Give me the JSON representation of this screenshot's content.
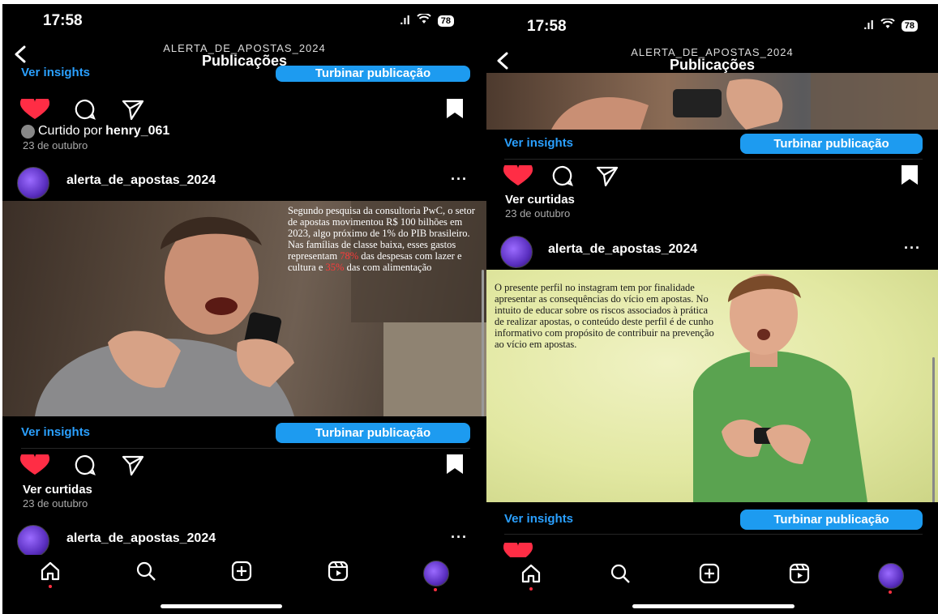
{
  "left": {
    "status": {
      "time": "17:58",
      "battery": "78"
    },
    "nav": {
      "username": "ALERTA_DE_APOSTAS_2024",
      "title": "Publicações"
    },
    "top": {
      "insights_label": "Ver insights",
      "boost_label": "Turbinar publicação",
      "liked_prefix": "Curtido por ",
      "liked_user": "henry_061",
      "date": "23 de outubro"
    },
    "post1": {
      "username": "alerta_de_apostas_2024",
      "caption_before_78": "Segundo pesquisa da consultoria PwC, o setor de apostas movimentou R$ 100 bilhões em 2023, algo próximo de 1% do PIB brasileiro. Nas famílias de classe baixa, esses gastos representam ",
      "pct_leisure": "78%",
      "caption_middle": " das despesas com lazer e cultura e ",
      "pct_food": "35%",
      "caption_after_35": " das com alimentação",
      "insights_label": "Ver insights",
      "boost_label": "Turbinar publicação",
      "likes_label": "Ver curtidas",
      "date": "23 de outubro"
    },
    "post2": {
      "username": "alerta_de_apostas_2024"
    }
  },
  "right": {
    "status": {
      "time": "17:58",
      "battery": "78"
    },
    "nav": {
      "username": "ALERTA_DE_APOSTAS_2024",
      "title": "Publicações"
    },
    "top": {
      "insights_label": "Ver insights",
      "boost_label": "Turbinar publicação",
      "likes_label": "Ver curtidas",
      "date": "23 de outubro"
    },
    "post1": {
      "username": "alerta_de_apostas_2024",
      "caption": "O presente perfil no instagram tem por finalidade apresentar as consequências do vício em apostas. No intuito de educar sobre os riscos associados à prática de realizar apostas, o conteúdo deste perfil é de cunho informativo com propósito de contribuir na prevenção ao vício em apostas.",
      "insights_label": "Ver insights",
      "boost_label": "Turbinar publicação"
    }
  },
  "icons": {
    "back": "back-chevron-icon",
    "heart": "heart-icon",
    "comment": "comment-icon",
    "share": "share-icon",
    "save": "bookmark-icon",
    "more": "more-icon",
    "home": "home-icon",
    "search": "search-icon",
    "create": "create-icon",
    "reels": "reels-icon",
    "profile": "profile-avatar-icon"
  },
  "colors": {
    "background": "#000000",
    "link": "#2aa0ff",
    "button": "#1d9bf0",
    "heart": "#ff2d45",
    "highlight": "#ff3a3a",
    "post2_bg": "#e6eca8"
  }
}
